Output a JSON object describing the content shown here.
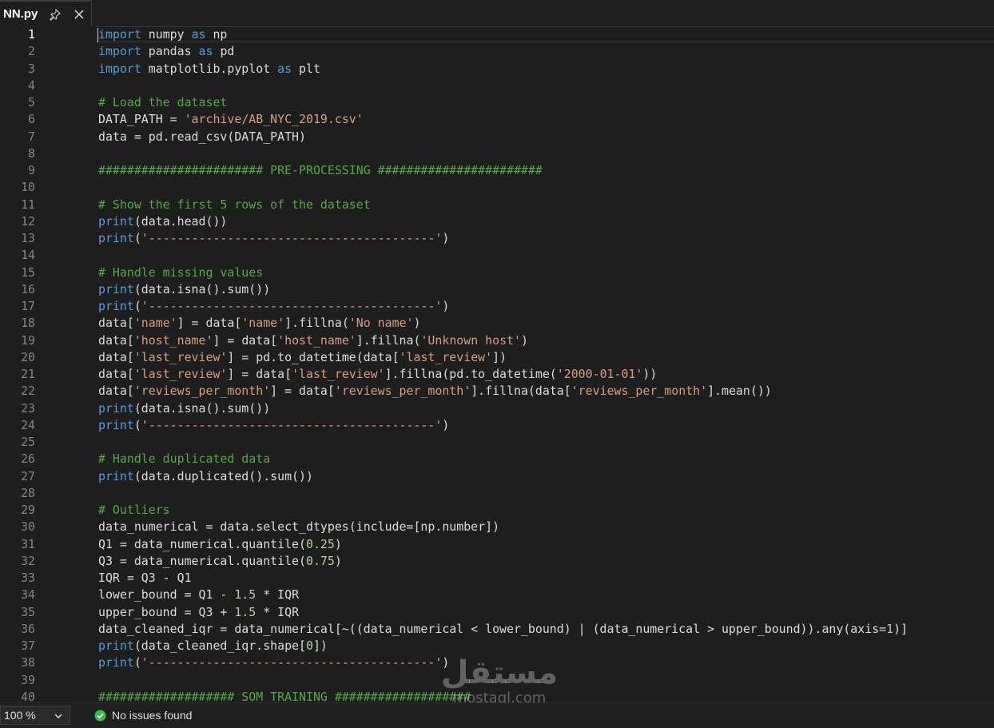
{
  "tab": {
    "title": "NN.py"
  },
  "editor": {
    "active_line": 1,
    "lines": [
      [
        [
          "kw",
          "import"
        ],
        [
          "",
          "numpy"
        ],
        [
          "kw",
          "as"
        ],
        [
          "",
          "np"
        ]
      ],
      [
        [
          "kw",
          "import"
        ],
        [
          "",
          "pandas"
        ],
        [
          "kw",
          "as"
        ],
        [
          "",
          "pd"
        ]
      ],
      [
        [
          "kw",
          "import"
        ],
        [
          "",
          "matplotlib.pyplot"
        ],
        [
          "kw",
          "as"
        ],
        [
          "",
          "plt"
        ]
      ],
      [],
      [
        [
          "cmt",
          "# Load the dataset"
        ]
      ],
      [
        [
          "",
          "DATA_PATH = "
        ],
        [
          "str",
          "'archive/AB_NYC_2019.csv'"
        ]
      ],
      [
        [
          "",
          "data = pd.read_csv(DATA_PATH)"
        ]
      ],
      [],
      [
        [
          "cmt",
          "####################### PRE-PROCESSING #######################"
        ]
      ],
      [],
      [
        [
          "cmt",
          "# Show the first 5 rows of the dataset"
        ]
      ],
      [
        [
          "kw",
          "print"
        ],
        [
          "",
          "(data.head())"
        ]
      ],
      [
        [
          "kw",
          "print"
        ],
        [
          "",
          "("
        ],
        [
          "str",
          "'----------------------------------------'"
        ],
        [
          "",
          ")"
        ]
      ],
      [],
      [
        [
          "cmt",
          "# Handle missing values"
        ]
      ],
      [
        [
          "kw",
          "print"
        ],
        [
          "",
          "(data.isna().sum())"
        ]
      ],
      [
        [
          "kw",
          "print"
        ],
        [
          "",
          "("
        ],
        [
          "str",
          "'----------------------------------------'"
        ],
        [
          "",
          ")"
        ]
      ],
      [
        [
          "",
          "data["
        ],
        [
          "str",
          "'name'"
        ],
        [
          "",
          "] = data["
        ],
        [
          "str",
          "'name'"
        ],
        [
          "",
          "].fillna("
        ],
        [
          "str",
          "'No name'"
        ],
        [
          "",
          ")"
        ]
      ],
      [
        [
          "",
          "data["
        ],
        [
          "str",
          "'host_name'"
        ],
        [
          "",
          "] = data["
        ],
        [
          "str",
          "'host_name'"
        ],
        [
          "",
          "].fillna("
        ],
        [
          "str",
          "'Unknown host'"
        ],
        [
          "",
          ")"
        ]
      ],
      [
        [
          "",
          "data["
        ],
        [
          "str",
          "'last_review'"
        ],
        [
          "",
          "] = pd.to_datetime(data["
        ],
        [
          "str",
          "'last_review'"
        ],
        [
          "",
          "])"
        ]
      ],
      [
        [
          "",
          "data["
        ],
        [
          "str",
          "'last_review'"
        ],
        [
          "",
          "] = data["
        ],
        [
          "str",
          "'last_review'"
        ],
        [
          "",
          "].fillna(pd.to_datetime("
        ],
        [
          "str",
          "'2000-01-01'"
        ],
        [
          "",
          "))"
        ]
      ],
      [
        [
          "",
          "data["
        ],
        [
          "str",
          "'reviews_per_month'"
        ],
        [
          "",
          "] = data["
        ],
        [
          "str",
          "'reviews_per_month'"
        ],
        [
          "",
          "].fillna(data["
        ],
        [
          "str",
          "'reviews_per_month'"
        ],
        [
          "",
          "].mean())"
        ]
      ],
      [
        [
          "kw",
          "print"
        ],
        [
          "",
          "(data.isna().sum())"
        ]
      ],
      [
        [
          "kw",
          "print"
        ],
        [
          "",
          "("
        ],
        [
          "str",
          "'----------------------------------------'"
        ],
        [
          "",
          ")"
        ]
      ],
      [],
      [
        [
          "cmt",
          "# Handle duplicated data"
        ]
      ],
      [
        [
          "kw",
          "print"
        ],
        [
          "",
          "(data.duplicated().sum())"
        ]
      ],
      [],
      [
        [
          "cmt",
          "# Outliers"
        ]
      ],
      [
        [
          "",
          "data_numerical = data.select_dtypes(include=[np.number])"
        ]
      ],
      [
        [
          "",
          "Q1 = data_numerical.quantile("
        ],
        [
          "num",
          "0.25"
        ],
        [
          "",
          ")"
        ]
      ],
      [
        [
          "",
          "Q3 = data_numerical.quantile("
        ],
        [
          "num",
          "0.75"
        ],
        [
          "",
          ")"
        ]
      ],
      [
        [
          "",
          "IQR = Q3 - Q1"
        ]
      ],
      [
        [
          "",
          "lower_bound = Q1 - "
        ],
        [
          "num",
          "1.5"
        ],
        [
          "",
          " * IQR"
        ]
      ],
      [
        [
          "",
          "upper_bound = Q3 + "
        ],
        [
          "num",
          "1.5"
        ],
        [
          "",
          " * IQR"
        ]
      ],
      [
        [
          "",
          "data_cleaned_iqr = data_numerical[~((data_numerical < lower_bound) | (data_numerical > upper_bound)).any(axis="
        ],
        [
          "num",
          "1"
        ],
        [
          "",
          ")]"
        ]
      ],
      [
        [
          "kw",
          "print"
        ],
        [
          "",
          "(data_cleaned_iqr.shape["
        ],
        [
          "num",
          "0"
        ],
        [
          "",
          "])"
        ]
      ],
      [
        [
          "kw",
          "print"
        ],
        [
          "",
          "("
        ],
        [
          "str",
          "'----------------------------------------'"
        ],
        [
          "",
          ")"
        ]
      ],
      [],
      [
        [
          "cmt",
          "################### SOM TRAINING ###################"
        ]
      ]
    ]
  },
  "watermark": {
    "arabic": "مستقل",
    "latin": "mostaql.com"
  },
  "statusbar": {
    "zoom": "100 %",
    "issues": "No issues found"
  },
  "colors": {
    "keyword": "#569cd6",
    "string": "#d69d85",
    "comment": "#57a64a",
    "number": "#b5cea8",
    "ok": "#3fb950"
  }
}
